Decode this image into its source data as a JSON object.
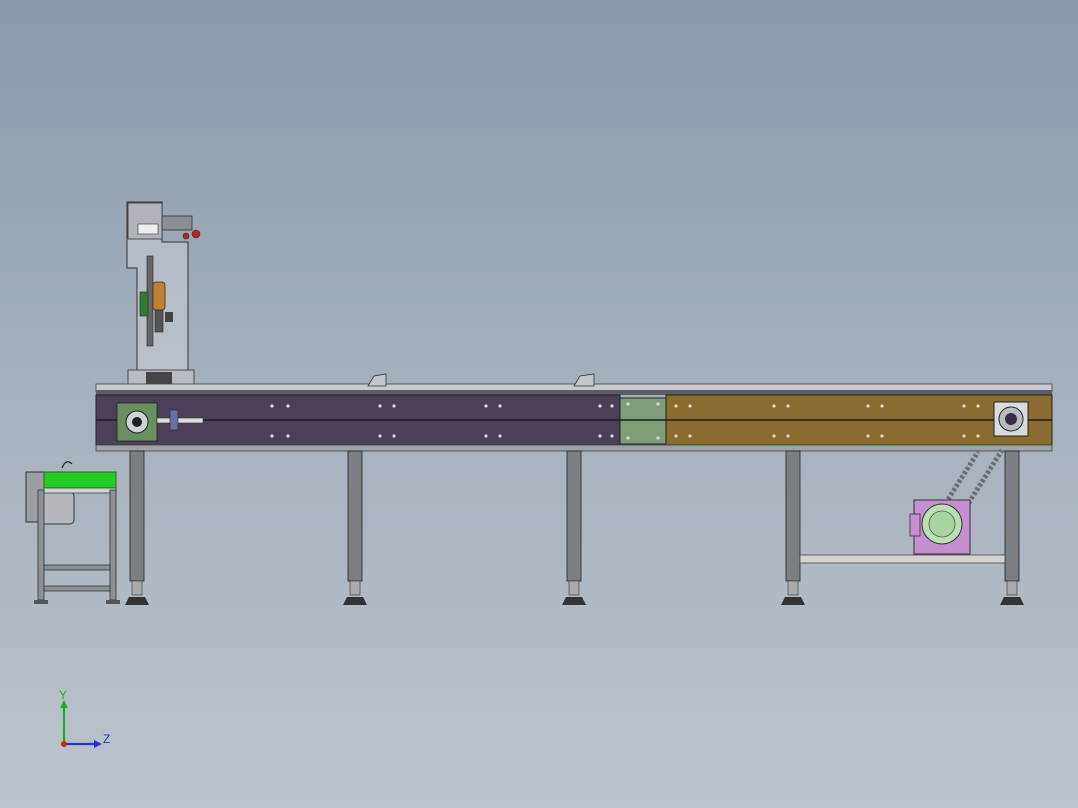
{
  "viewport": {
    "background_top": "#8a9aab",
    "background_bottom": "#bcc4cc"
  },
  "colors": {
    "frame_purple": "#4c3f58",
    "frame_brown": "#8a6c30",
    "plate_green": "#7f9e78",
    "roller_green": "#22cc22",
    "motor_magenta": "#c58fd0",
    "motor_green": "#b8e0b0",
    "steel": "#7b7f84"
  },
  "triad": {
    "y_label": "Y",
    "z_label": "Z",
    "y_color": "#22aa22",
    "z_color": "#2233cc",
    "x_color": "#cc2222"
  }
}
